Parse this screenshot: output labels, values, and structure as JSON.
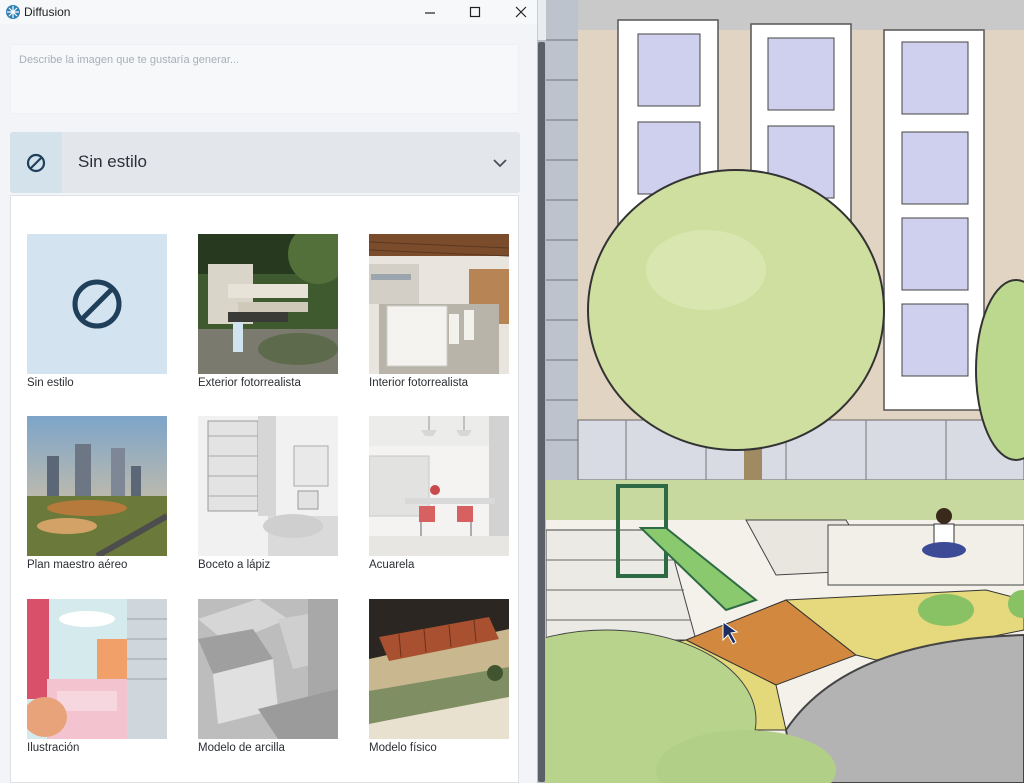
{
  "window": {
    "title": "Diffusion",
    "minimize_glyph": "—",
    "maximize_glyph": "☐",
    "close_glyph": "✕"
  },
  "prompt": {
    "placeholder": "Describe la imagen que te gustaría generar..."
  },
  "style_select": {
    "selected": "Sin estilo",
    "icon": "no-style-icon",
    "chevron": "chevron-down-icon"
  },
  "styles": [
    {
      "label": "Sin estilo",
      "icon": "no-style-icon",
      "selected": true
    },
    {
      "label": "Exterior fotorrealista"
    },
    {
      "label": "Interior fotorrealista"
    },
    {
      "label": "Plan maestro aéreo"
    },
    {
      "label": "Boceto a lápiz"
    },
    {
      "label": "Acuarela"
    },
    {
      "label": "Ilustración"
    },
    {
      "label": "Modelo de arcilla"
    },
    {
      "label": "Modelo físico"
    }
  ],
  "colors": {
    "accent": "#1f3f5b",
    "selected_tile_bg": "#d3e3ef",
    "select_bg": "#e3e7ec"
  }
}
